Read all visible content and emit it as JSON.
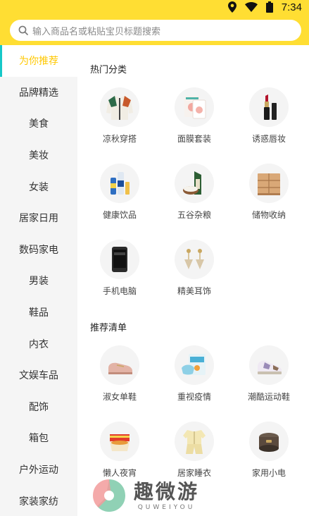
{
  "status": {
    "time": "7:34"
  },
  "search": {
    "placeholder": "输入商品名或粘贴宝贝标题搜索"
  },
  "sidebar": {
    "items": [
      {
        "label": "为你推荐",
        "active": true
      },
      {
        "label": "品牌精选"
      },
      {
        "label": "美食"
      },
      {
        "label": "美妆"
      },
      {
        "label": "女装"
      },
      {
        "label": "居家日用"
      },
      {
        "label": "数码家电"
      },
      {
        "label": "男装"
      },
      {
        "label": "鞋品"
      },
      {
        "label": "内衣"
      },
      {
        "label": "文娱车品"
      },
      {
        "label": "配饰"
      },
      {
        "label": "箱包"
      },
      {
        "label": "户外运动"
      },
      {
        "label": "家装家纺"
      }
    ]
  },
  "hot": {
    "title": "热门分类",
    "items": [
      {
        "label": "凉秋穿搭",
        "icon": "jacket-icon"
      },
      {
        "label": "面膜套装",
        "icon": "face-mask-icon"
      },
      {
        "label": "诱惑唇妆",
        "icon": "lipstick-icon"
      },
      {
        "label": "健康饮品",
        "icon": "drink-bottles-icon"
      },
      {
        "label": "五谷杂粮",
        "icon": "grain-bag-icon"
      },
      {
        "label": "储物收纳",
        "icon": "storage-cabinet-icon"
      },
      {
        "label": "手机电脑",
        "icon": "phone-icon"
      },
      {
        "label": "精美耳饰",
        "icon": "earrings-icon"
      }
    ]
  },
  "recommend": {
    "title": "推荐清单",
    "items": [
      {
        "label": "淑女单鞋",
        "icon": "loafer-shoe-icon"
      },
      {
        "label": "重视疫情",
        "icon": "mask-box-icon"
      },
      {
        "label": "潮酷运动鞋",
        "icon": "sneaker-icon"
      },
      {
        "label": "懒人夜宵",
        "icon": "snack-box-icon"
      },
      {
        "label": "居家睡衣",
        "icon": "pajamas-icon"
      },
      {
        "label": "家用小电",
        "icon": "rice-cooker-icon"
      }
    ]
  },
  "watermark": {
    "cn": "趣微游",
    "en": "QUWEIYOU"
  }
}
